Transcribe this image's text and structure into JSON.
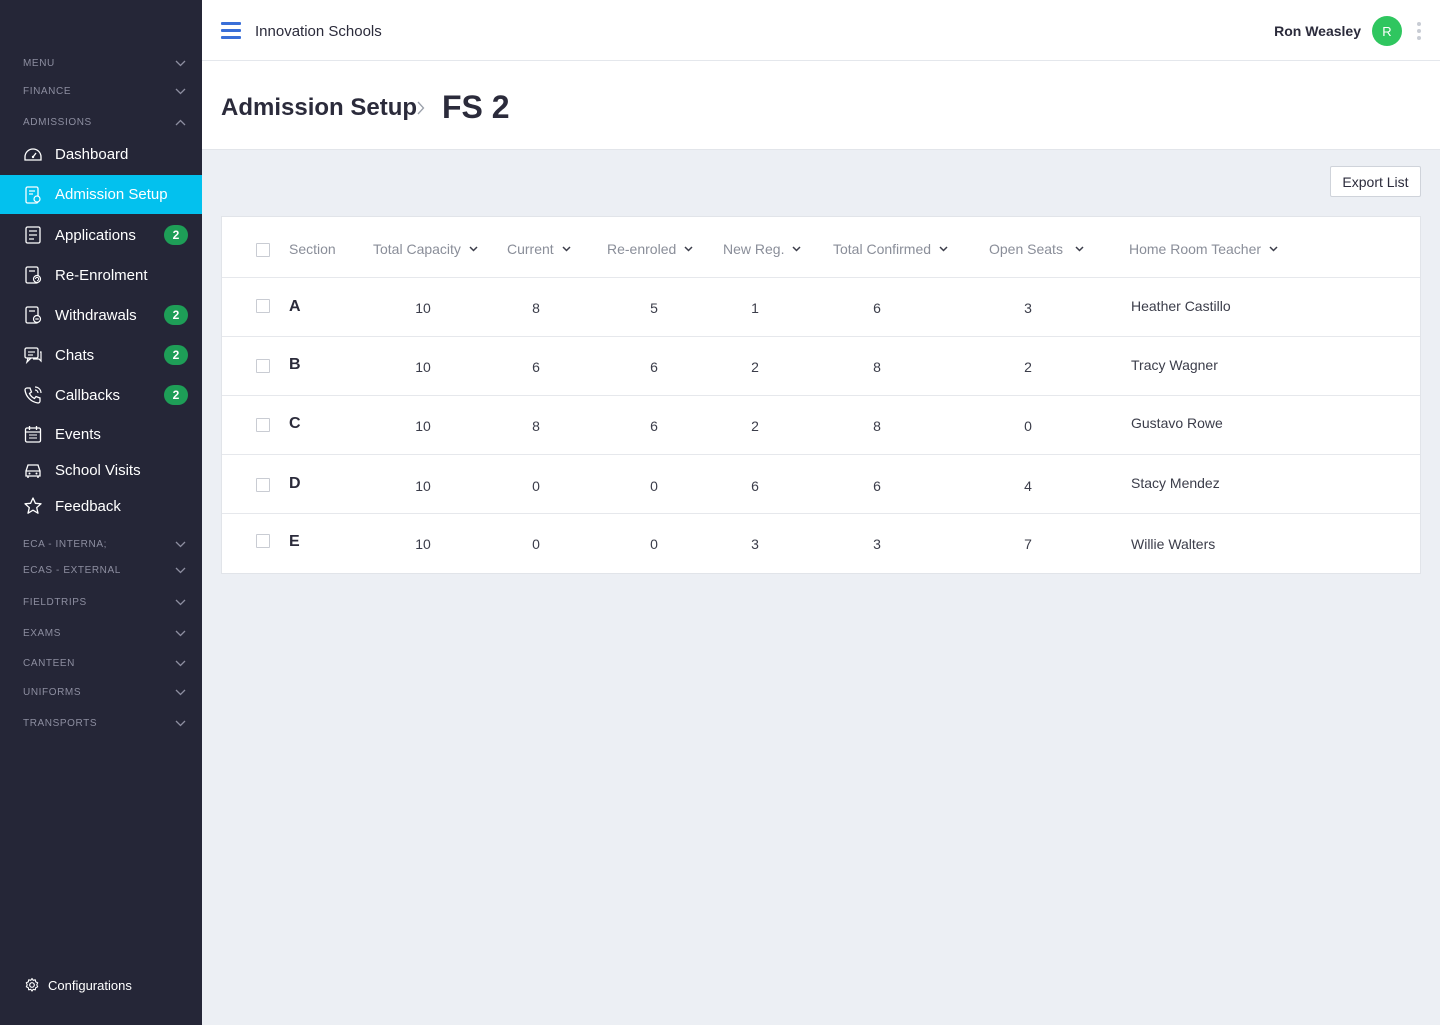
{
  "sidebar": {
    "sections_top": [
      {
        "label": "MENU",
        "expanded": false
      },
      {
        "label": "FINANCE",
        "expanded": false
      },
      {
        "label": "ADMISSIONS",
        "expanded": true
      }
    ],
    "items": [
      {
        "label": "Dashboard",
        "icon": "dashboard-icon",
        "badge": null
      },
      {
        "label": "Admission Setup",
        "icon": "admission-setup-icon",
        "badge": null,
        "active": true
      },
      {
        "label": "Applications",
        "icon": "applications-icon",
        "badge": "2"
      },
      {
        "label": "Re-Enrolment",
        "icon": "re-enrolment-icon",
        "badge": null
      },
      {
        "label": "Withdrawals",
        "icon": "withdrawals-icon",
        "badge": "2"
      },
      {
        "label": "Chats",
        "icon": "chat-icon",
        "badge": "2"
      },
      {
        "label": "Callbacks",
        "icon": "phone-icon",
        "badge": "2"
      },
      {
        "label": "Events",
        "icon": "calendar-icon",
        "badge": null
      },
      {
        "label": "School Visits",
        "icon": "car-icon",
        "badge": null
      },
      {
        "label": "Feedback",
        "icon": "star-icon",
        "badge": null
      }
    ],
    "sections_bottom": [
      {
        "label": "ECA - INTERNA;"
      },
      {
        "label": "ECAS - EXTERNAL"
      },
      {
        "label": "FIELDTRIPS"
      },
      {
        "label": "EXAMS"
      },
      {
        "label": "CANTEEN"
      },
      {
        "label": "UNIFORMS"
      },
      {
        "label": "TRANSPORTS"
      }
    ],
    "configurations_label": "Configurations"
  },
  "topbar": {
    "org_name": "Innovation Schools",
    "user_name": "Ron Weasley",
    "avatar_initial": "R"
  },
  "header": {
    "breadcrumb_parent": "Admission Setup",
    "title": "FS 2"
  },
  "toolbar": {
    "export_label": "Export List"
  },
  "table": {
    "columns": [
      "Section",
      "Total Capacity",
      "Current",
      "Re-enroled",
      "New Reg.",
      "Total Confirmed",
      "Open Seats",
      "Home Room Teacher"
    ],
    "rows": [
      {
        "section": "A",
        "total_capacity": "10",
        "current": "8",
        "re_enroled": "5",
        "new_reg": "1",
        "total_confirmed": "6",
        "open_seats": "3",
        "teacher": "Heather Castillo"
      },
      {
        "section": "B",
        "total_capacity": "10",
        "current": "6",
        "re_enroled": "6",
        "new_reg": "2",
        "total_confirmed": "8",
        "open_seats": "2",
        "teacher": "Tracy Wagner"
      },
      {
        "section": "C",
        "total_capacity": "10",
        "current": "8",
        "re_enroled": "6",
        "new_reg": "2",
        "total_confirmed": "8",
        "open_seats": "0",
        "teacher": "Gustavo Rowe"
      },
      {
        "section": "D",
        "total_capacity": "10",
        "current": "0",
        "re_enroled": "0",
        "new_reg": "6",
        "total_confirmed": "6",
        "open_seats": "4",
        "teacher": "Stacy Mendez"
      },
      {
        "section": "E",
        "total_capacity": "10",
        "current": "0",
        "re_enroled": "0",
        "new_reg": "3",
        "total_confirmed": "3",
        "open_seats": "7",
        "teacher": "Willie Walters"
      }
    ]
  },
  "colors": {
    "sidebar_bg": "#252637",
    "active_item": "#03c1ee",
    "badge": "#1e9e57",
    "avatar": "#2fc65f",
    "accent": "#3a6fd8"
  }
}
